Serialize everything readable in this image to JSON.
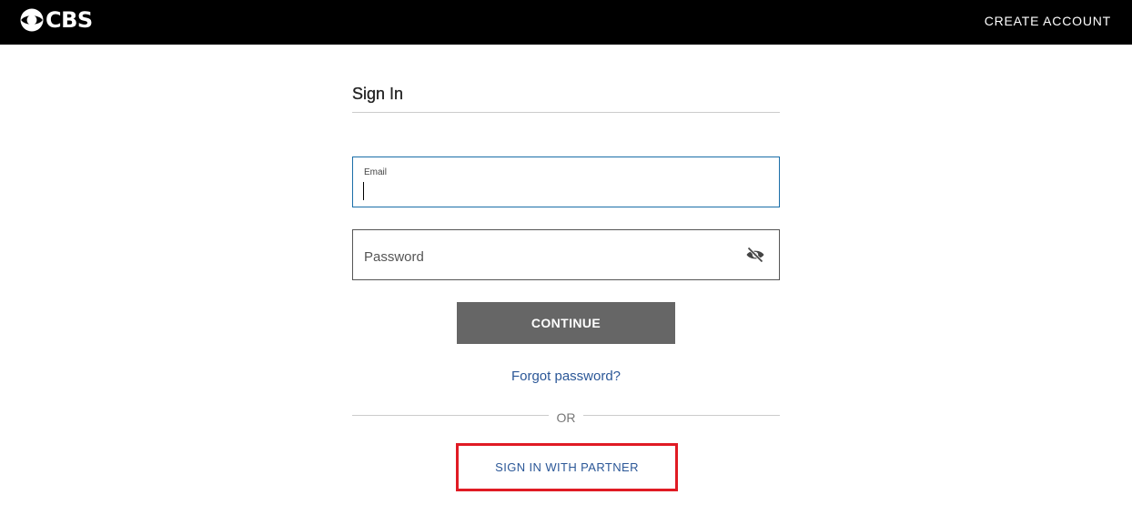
{
  "header": {
    "logo_text": "CBS",
    "create_account_label": "CREATE ACCOUNT"
  },
  "signin": {
    "title": "Sign In",
    "email": {
      "label": "Email",
      "value": ""
    },
    "password": {
      "placeholder": "Password",
      "toggle_icon": "eye-slash-icon"
    },
    "continue_label": "CONTINUE",
    "forgot_password_label": "Forgot password?",
    "or_label": "OR",
    "partner_label": "SIGN IN WITH PARTNER"
  },
  "colors": {
    "header_bg": "#000000",
    "accent_link": "#2b5797",
    "continue_bg": "#666666",
    "email_focus_border": "#1a6ea8",
    "highlight_red": "#e01b24"
  }
}
